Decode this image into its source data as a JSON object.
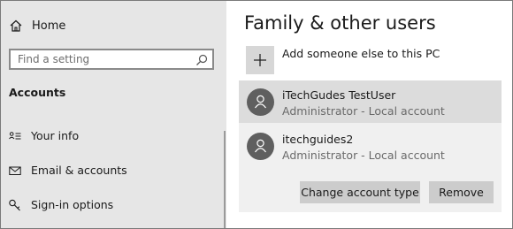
{
  "sidebar": {
    "home": {
      "label": "Home",
      "icon": "home-icon"
    },
    "search": {
      "placeholder": "Find a setting",
      "icon": "search-icon"
    },
    "section_title": "Accounts",
    "items": [
      {
        "label": "Your info",
        "icon": "person-card-icon"
      },
      {
        "label": "Email & accounts",
        "icon": "mail-icon"
      },
      {
        "label": "Sign-in options",
        "icon": "key-icon"
      }
    ]
  },
  "main": {
    "title": "Family & other users",
    "add_label": "Add someone else to this PC",
    "users": [
      {
        "name": "iTechGudes TestUser",
        "role": "Administrator - Local account",
        "selected": true
      },
      {
        "name": "itechguides2",
        "role": "Administrator - Local account",
        "selected": false
      }
    ],
    "actions": {
      "change_type": "Change account type",
      "remove": "Remove"
    }
  },
  "colors": {
    "sidebar_bg": "#e6e6e6",
    "selected_row": "#dcdcdc",
    "panel_bg": "#f0f0f0",
    "button_bg": "#cccccc",
    "avatar": "#5f5f5f"
  }
}
